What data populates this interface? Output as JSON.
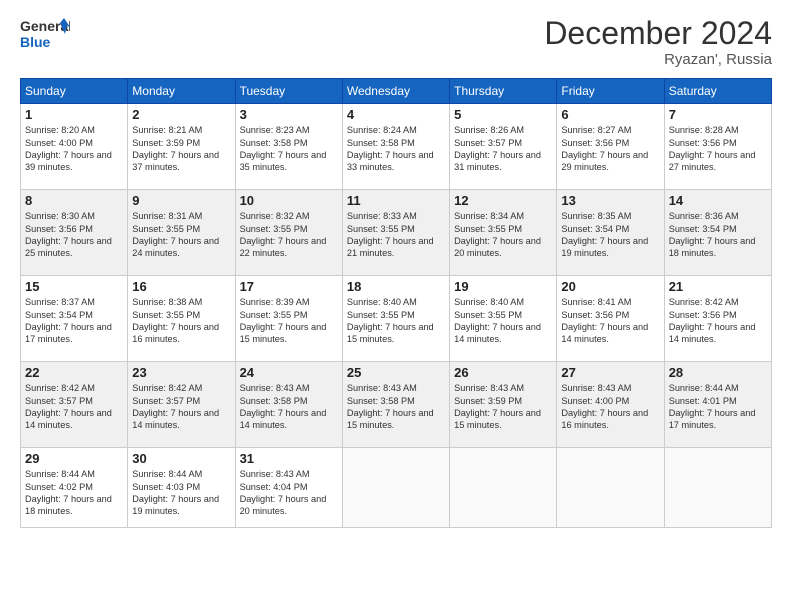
{
  "logo": {
    "line1": "General",
    "line2": "Blue"
  },
  "title": "December 2024",
  "subtitle": "Ryazan', Russia",
  "weekdays": [
    "Sunday",
    "Monday",
    "Tuesday",
    "Wednesday",
    "Thursday",
    "Friday",
    "Saturday"
  ],
  "weeks": [
    [
      {
        "day": "1",
        "sunrise": "8:20 AM",
        "sunset": "4:00 PM",
        "daylight": "7 hours and 39 minutes."
      },
      {
        "day": "2",
        "sunrise": "8:21 AM",
        "sunset": "3:59 PM",
        "daylight": "7 hours and 37 minutes."
      },
      {
        "day": "3",
        "sunrise": "8:23 AM",
        "sunset": "3:58 PM",
        "daylight": "7 hours and 35 minutes."
      },
      {
        "day": "4",
        "sunrise": "8:24 AM",
        "sunset": "3:58 PM",
        "daylight": "7 hours and 33 minutes."
      },
      {
        "day": "5",
        "sunrise": "8:26 AM",
        "sunset": "3:57 PM",
        "daylight": "7 hours and 31 minutes."
      },
      {
        "day": "6",
        "sunrise": "8:27 AM",
        "sunset": "3:56 PM",
        "daylight": "7 hours and 29 minutes."
      },
      {
        "day": "7",
        "sunrise": "8:28 AM",
        "sunset": "3:56 PM",
        "daylight": "7 hours and 27 minutes."
      }
    ],
    [
      {
        "day": "8",
        "sunrise": "8:30 AM",
        "sunset": "3:56 PM",
        "daylight": "7 hours and 25 minutes."
      },
      {
        "day": "9",
        "sunrise": "8:31 AM",
        "sunset": "3:55 PM",
        "daylight": "7 hours and 24 minutes."
      },
      {
        "day": "10",
        "sunrise": "8:32 AM",
        "sunset": "3:55 PM",
        "daylight": "7 hours and 22 minutes."
      },
      {
        "day": "11",
        "sunrise": "8:33 AM",
        "sunset": "3:55 PM",
        "daylight": "7 hours and 21 minutes."
      },
      {
        "day": "12",
        "sunrise": "8:34 AM",
        "sunset": "3:55 PM",
        "daylight": "7 hours and 20 minutes."
      },
      {
        "day": "13",
        "sunrise": "8:35 AM",
        "sunset": "3:54 PM",
        "daylight": "7 hours and 19 minutes."
      },
      {
        "day": "14",
        "sunrise": "8:36 AM",
        "sunset": "3:54 PM",
        "daylight": "7 hours and 18 minutes."
      }
    ],
    [
      {
        "day": "15",
        "sunrise": "8:37 AM",
        "sunset": "3:54 PM",
        "daylight": "7 hours and 17 minutes."
      },
      {
        "day": "16",
        "sunrise": "8:38 AM",
        "sunset": "3:55 PM",
        "daylight": "7 hours and 16 minutes."
      },
      {
        "day": "17",
        "sunrise": "8:39 AM",
        "sunset": "3:55 PM",
        "daylight": "7 hours and 15 minutes."
      },
      {
        "day": "18",
        "sunrise": "8:40 AM",
        "sunset": "3:55 PM",
        "daylight": "7 hours and 15 minutes."
      },
      {
        "day": "19",
        "sunrise": "8:40 AM",
        "sunset": "3:55 PM",
        "daylight": "7 hours and 14 minutes."
      },
      {
        "day": "20",
        "sunrise": "8:41 AM",
        "sunset": "3:56 PM",
        "daylight": "7 hours and 14 minutes."
      },
      {
        "day": "21",
        "sunrise": "8:42 AM",
        "sunset": "3:56 PM",
        "daylight": "7 hours and 14 minutes."
      }
    ],
    [
      {
        "day": "22",
        "sunrise": "8:42 AM",
        "sunset": "3:57 PM",
        "daylight": "7 hours and 14 minutes."
      },
      {
        "day": "23",
        "sunrise": "8:42 AM",
        "sunset": "3:57 PM",
        "daylight": "7 hours and 14 minutes."
      },
      {
        "day": "24",
        "sunrise": "8:43 AM",
        "sunset": "3:58 PM",
        "daylight": "7 hours and 14 minutes."
      },
      {
        "day": "25",
        "sunrise": "8:43 AM",
        "sunset": "3:58 PM",
        "daylight": "7 hours and 15 minutes."
      },
      {
        "day": "26",
        "sunrise": "8:43 AM",
        "sunset": "3:59 PM",
        "daylight": "7 hours and 15 minutes."
      },
      {
        "day": "27",
        "sunrise": "8:43 AM",
        "sunset": "4:00 PM",
        "daylight": "7 hours and 16 minutes."
      },
      {
        "day": "28",
        "sunrise": "8:44 AM",
        "sunset": "4:01 PM",
        "daylight": "7 hours and 17 minutes."
      }
    ],
    [
      {
        "day": "29",
        "sunrise": "8:44 AM",
        "sunset": "4:02 PM",
        "daylight": "7 hours and 18 minutes."
      },
      {
        "day": "30",
        "sunrise": "8:44 AM",
        "sunset": "4:03 PM",
        "daylight": "7 hours and 19 minutes."
      },
      {
        "day": "31",
        "sunrise": "8:43 AM",
        "sunset": "4:04 PM",
        "daylight": "7 hours and 20 minutes."
      },
      null,
      null,
      null,
      null
    ]
  ],
  "labels": {
    "sunrise": "Sunrise:",
    "sunset": "Sunset:",
    "daylight": "Daylight:"
  }
}
